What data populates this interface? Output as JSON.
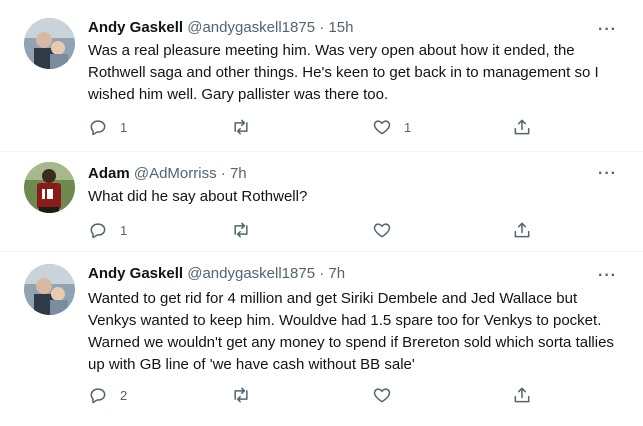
{
  "tweets": [
    {
      "name": "Andy Gaskell",
      "handle": "@andygaskell1875",
      "dot": "·",
      "time": "15h",
      "text": "Was a real pleasure meeting him. Was very open about how it ended, the Rothwell saga and other things. He's keen to get back in to management so I wished him well. Gary pallister was there too.",
      "replies": "1",
      "retweets": "",
      "likes": "1",
      "avatar_icon": "avatar-photo"
    },
    {
      "name": "Adam",
      "handle": "@AdMorriss",
      "dot": "·",
      "time": "7h",
      "text": "What did he say about Rothwell?",
      "replies": "1",
      "retweets": "",
      "likes": "",
      "avatar_icon": "avatar-photo"
    },
    {
      "name": "Andy Gaskell",
      "handle": "@andygaskell1875",
      "dot": "·",
      "time": "7h",
      "text": "Wanted to get rid for 4 million and get Siriki Dembele and Jed Wallace but Venkys wanted to keep him. Wouldve had 1.5 spare too for Venkys to pocket. Warned we wouldn't get any money to spend if Brereton sold which sorta tallies up with GB line of 'we have cash without BB sale'",
      "replies": "2",
      "retweets": "",
      "likes": "",
      "avatar_icon": "avatar-photo"
    }
  ],
  "more_label": "···",
  "icons": {
    "reply": "reply-icon",
    "retweet": "retweet-icon",
    "like": "like-icon",
    "share": "share-icon",
    "more": "more-icon"
  },
  "colors": {
    "text": "#0f1419",
    "secondary": "#536471",
    "divider": "#eff3f4"
  }
}
